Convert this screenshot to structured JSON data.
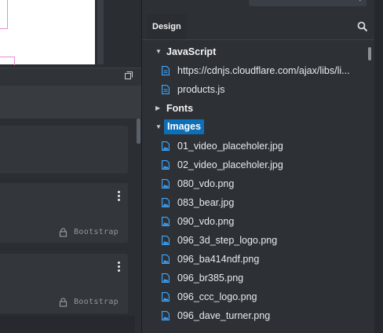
{
  "panel": {
    "tab_label": "Design"
  },
  "tree": {
    "groups": [
      {
        "label": "JavaScript",
        "expanded": true,
        "selected": false,
        "items": [
          "https://cdnjs.cloudflare.com/ajax/libs/li...",
          "products.js"
        ]
      },
      {
        "label": "Fonts",
        "expanded": false,
        "selected": false,
        "items": []
      },
      {
        "label": "Images",
        "expanded": true,
        "selected": true,
        "items": [
          "01_video_placeholer.jpg",
          "02_video_placeholer.jpg",
          "080_vdo.png",
          "083_bear.jpg",
          "090_vdo.png",
          "096_3d_step_logo.png",
          "096_ba414ndf.png",
          "096_br385.png",
          "096_ccc_logo.png",
          "096_dave_turner.png"
        ]
      }
    ]
  },
  "cards": [
    {
      "tag": ""
    },
    {
      "tag": "Bootstrap"
    },
    {
      "tag": "Bootstrap"
    }
  ],
  "colors": {
    "accent": "#0d6fb8",
    "background": "#2d3136",
    "pink_outline": "#e98ad6"
  },
  "icons": {
    "search": "search-icon",
    "expand": "expand-icon",
    "lock": "lock-icon",
    "menu": "vertical-dots-icon",
    "js_file": "file-icon",
    "image_file": "image-file-icon"
  }
}
